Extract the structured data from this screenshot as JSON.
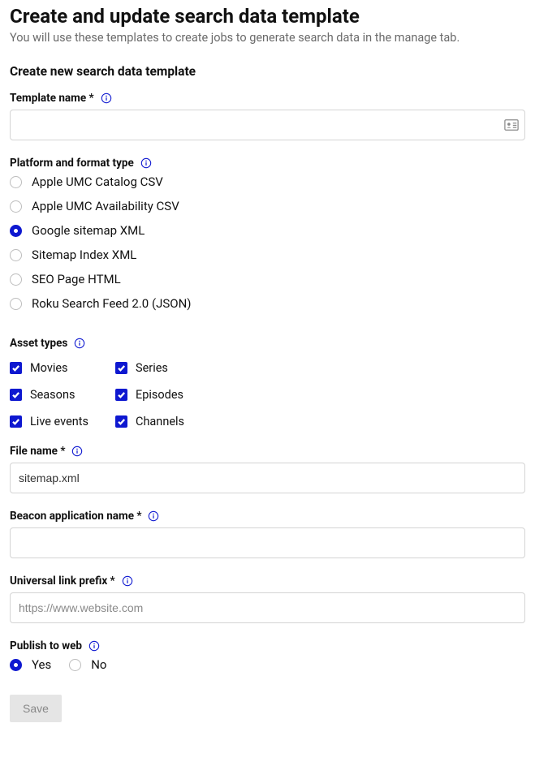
{
  "header": {
    "title": "Create and update search data template",
    "subtitle": "You will use these templates to create jobs to generate search data in the manage tab."
  },
  "form": {
    "section_title": "Create new search data template",
    "template_name": {
      "label": "Template name *",
      "value": ""
    },
    "platform_format": {
      "label": "Platform and format type",
      "options": [
        {
          "label": "Apple UMC Catalog CSV",
          "selected": false
        },
        {
          "label": "Apple UMC Availability CSV",
          "selected": false
        },
        {
          "label": "Google sitemap XML",
          "selected": true
        },
        {
          "label": "Sitemap Index XML",
          "selected": false
        },
        {
          "label": "SEO Page HTML",
          "selected": false
        },
        {
          "label": "Roku Search Feed 2.0 (JSON)",
          "selected": false
        }
      ]
    },
    "asset_types": {
      "label": "Asset types",
      "options": [
        {
          "label": "Movies",
          "checked": true
        },
        {
          "label": "Series",
          "checked": true
        },
        {
          "label": "Seasons",
          "checked": true
        },
        {
          "label": "Episodes",
          "checked": true
        },
        {
          "label": "Live events",
          "checked": true
        },
        {
          "label": "Channels",
          "checked": true
        }
      ]
    },
    "file_name": {
      "label": "File name *",
      "value": "sitemap.xml"
    },
    "beacon_app_name": {
      "label": "Beacon application name *",
      "value": ""
    },
    "universal_link_prefix": {
      "label": "Universal link prefix *",
      "placeholder": "https://www.website.com",
      "value": ""
    },
    "publish_to_web": {
      "label": "Publish to web",
      "options": [
        {
          "label": "Yes",
          "selected": true
        },
        {
          "label": "No",
          "selected": false
        }
      ]
    },
    "save_button": "Save"
  }
}
